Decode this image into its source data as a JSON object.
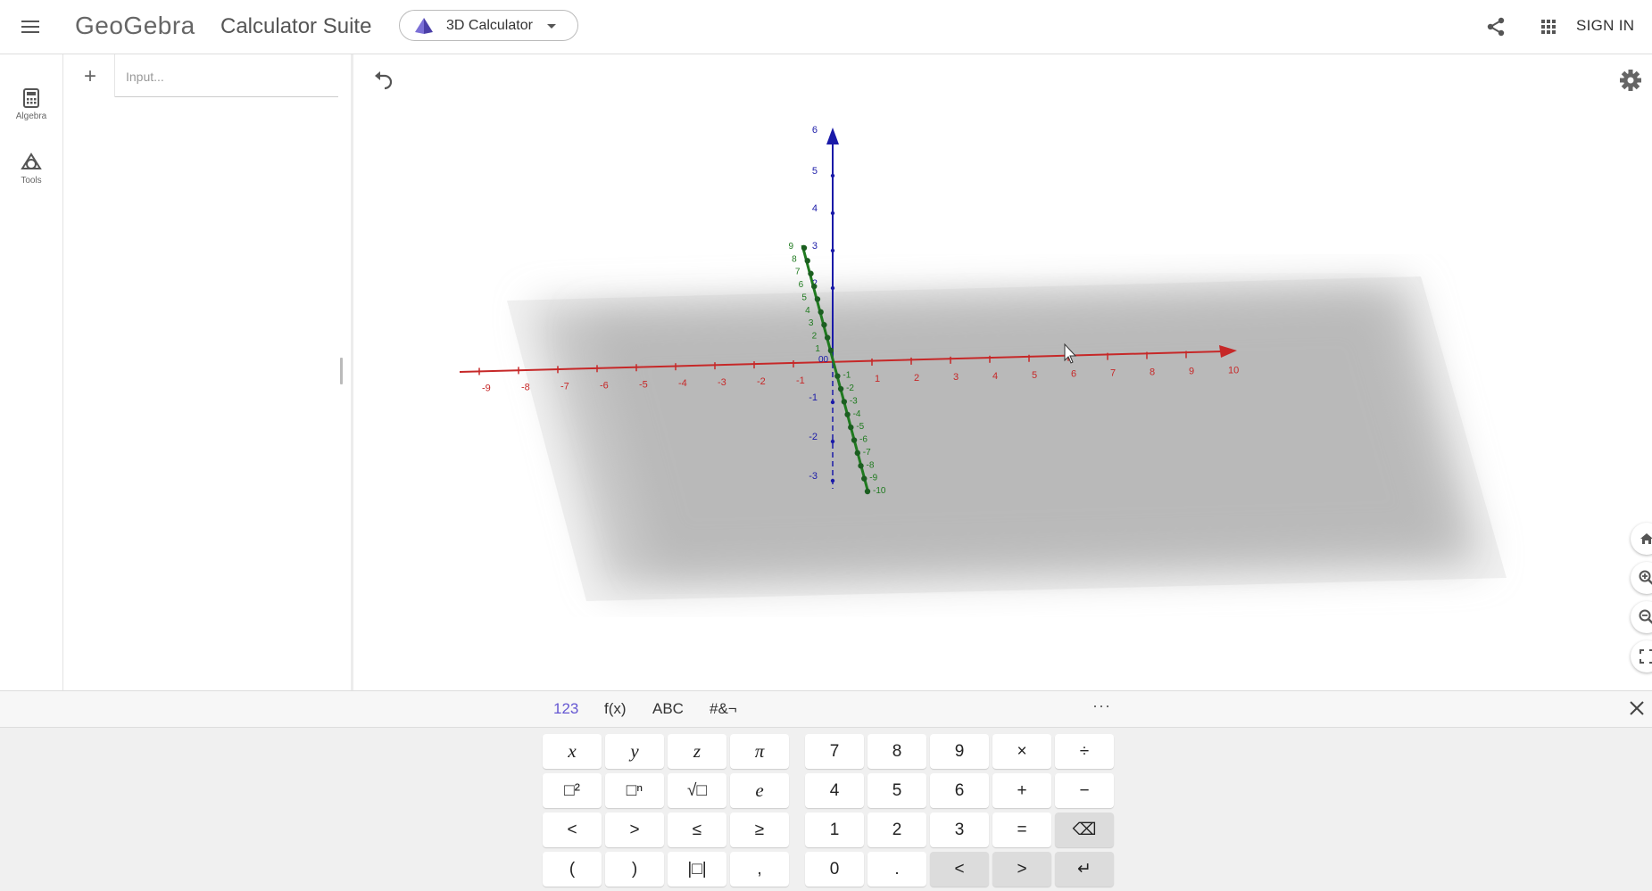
{
  "header": {
    "logo": "GeoGebra",
    "title": "Calculator Suite",
    "app_selector": "3D Calculator",
    "sign_in": "SIGN IN"
  },
  "rail": {
    "items": [
      {
        "label": "Algebra",
        "icon": "calculator-icon"
      },
      {
        "label": "Tools",
        "icon": "shapes-icon"
      }
    ]
  },
  "algebra": {
    "add_label": "+",
    "input_placeholder": "Input...",
    "input_value": ""
  },
  "view3d": {
    "x_axis": {
      "color": "#c62828",
      "ticks": [
        "-9",
        "-8",
        "-7",
        "-6",
        "-5",
        "-4",
        "-3",
        "-2",
        "-1",
        "1",
        "2",
        "3",
        "4",
        "5",
        "6",
        "7",
        "8",
        "9",
        "10"
      ]
    },
    "z_axis": {
      "color": "#1a1aa8",
      "ticks": [
        "2",
        "3",
        "4",
        "5",
        "6",
        "-1",
        "-2",
        "-3"
      ]
    },
    "y_axis": {
      "color": "#1f7a1f",
      "ticks": [
        "9",
        "8",
        "7",
        "6",
        "5",
        "4",
        "3",
        "2",
        "1",
        "-1",
        "-2",
        "-3",
        "-4",
        "-5",
        "-6",
        "-7",
        "-8",
        "-9",
        "-10"
      ]
    },
    "origin_label": "00",
    "plane_color": "#c0c0c0",
    "buttons": [
      "home-icon",
      "zoom-in-icon",
      "zoom-out-icon",
      "fullscreen-icon"
    ]
  },
  "keyboard": {
    "tabs": [
      "123",
      "f(x)",
      "ABC",
      "#&¬"
    ],
    "active_tab": "123",
    "more": "···",
    "left_keys": [
      [
        "x",
        "y",
        "z",
        "π"
      ],
      [
        "□²",
        "□ⁿ",
        "√□",
        "e"
      ],
      [
        "<",
        ">",
        "≤",
        "≥"
      ],
      [
        "(",
        ")",
        "|□|",
        ","
      ]
    ],
    "right_keys": [
      [
        "7",
        "8",
        "9",
        "×",
        "÷"
      ],
      [
        "4",
        "5",
        "6",
        "+",
        "−"
      ],
      [
        "1",
        "2",
        "3",
        "=",
        "⌫"
      ],
      [
        "0",
        ".",
        "<",
        ">",
        "↵"
      ]
    ]
  }
}
